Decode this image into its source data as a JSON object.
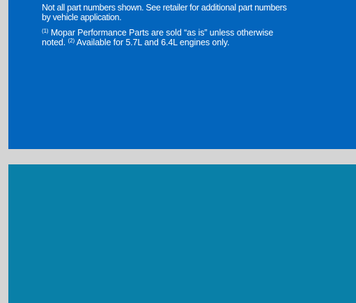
{
  "footnotes": {
    "intro_line1": "Not all part numbers shown. See retailer for additional part numbers",
    "intro_line2": "by vehicle application.",
    "marker_1": "(1)",
    "note_1": " Mopar Performance Parts are sold “as is” unless otherwise",
    "note_1_cont": "noted. ",
    "marker_2": "(2)",
    "note_2": " Available for 5.7L and 6.4L engines only."
  },
  "colors": {
    "page_background": "#d4d4d4",
    "upper_panel": "#0365bd",
    "lower_panel": "#0980a8",
    "text": "#ffffff"
  }
}
